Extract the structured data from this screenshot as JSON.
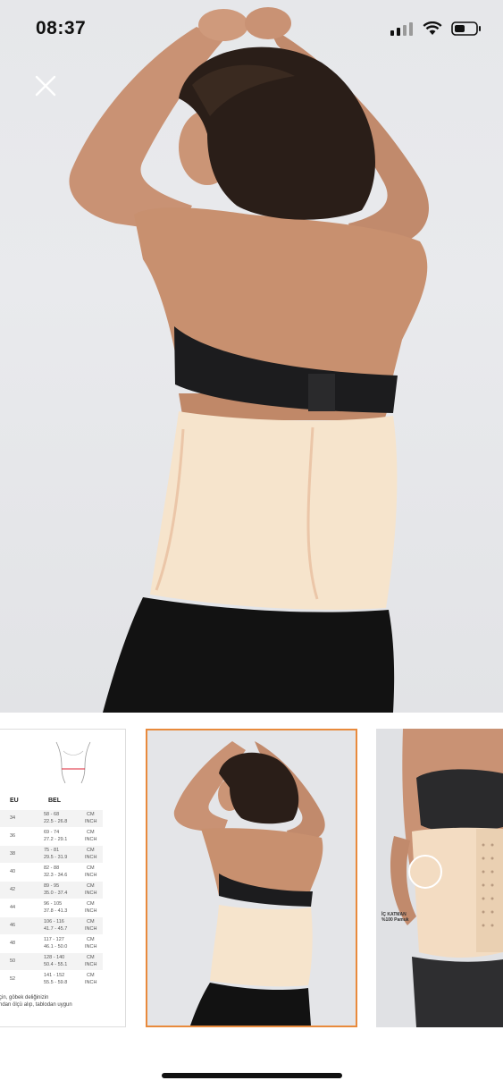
{
  "status_bar": {
    "time": "08:37"
  },
  "viewer": {
    "close_icon": "close-icon"
  },
  "size_chart": {
    "headers": {
      "eu": "EU",
      "bel": "BEL"
    },
    "rows": [
      {
        "eu": "34",
        "cm": "58 - 68",
        "inch": "22.5 - 26.8"
      },
      {
        "eu": "36",
        "cm": "69 - 74",
        "inch": "27.2 - 29.1"
      },
      {
        "eu": "38",
        "cm": "75 - 81",
        "inch": "29.5 - 31.9"
      },
      {
        "eu": "40",
        "cm": "82 - 88",
        "inch": "32.3 - 34.6"
      },
      {
        "eu": "42",
        "cm": "89 - 95",
        "inch": "35.0 - 37.4"
      },
      {
        "eu": "44",
        "cm": "96 - 105",
        "inch": "37.8 - 41.3"
      },
      {
        "eu": "46",
        "cm": "106 - 116",
        "inch": "41.7 - 45.7"
      },
      {
        "eu": "48",
        "cm": "117 - 127",
        "inch": "46.1 - 50.0"
      },
      {
        "eu": "50",
        "cm": "128 - 140",
        "inch": "50.4 - 55.1"
      },
      {
        "eu": "52",
        "cm": "141 - 152",
        "inch": "55.5 - 59.8"
      }
    ],
    "unit_cm": "CM",
    "unit_inch": "INCH",
    "note_line1": "çin, göbek deliğinizin",
    "note_line2": "ndan ölçü alıp, tablodan uygun"
  },
  "third_thumb": {
    "label_line1": "İÇ KATMAN",
    "label_line2": "%100 Pamuk"
  },
  "colors": {
    "selected_border": "#e88a3c",
    "garment": "#f6e4cc"
  }
}
